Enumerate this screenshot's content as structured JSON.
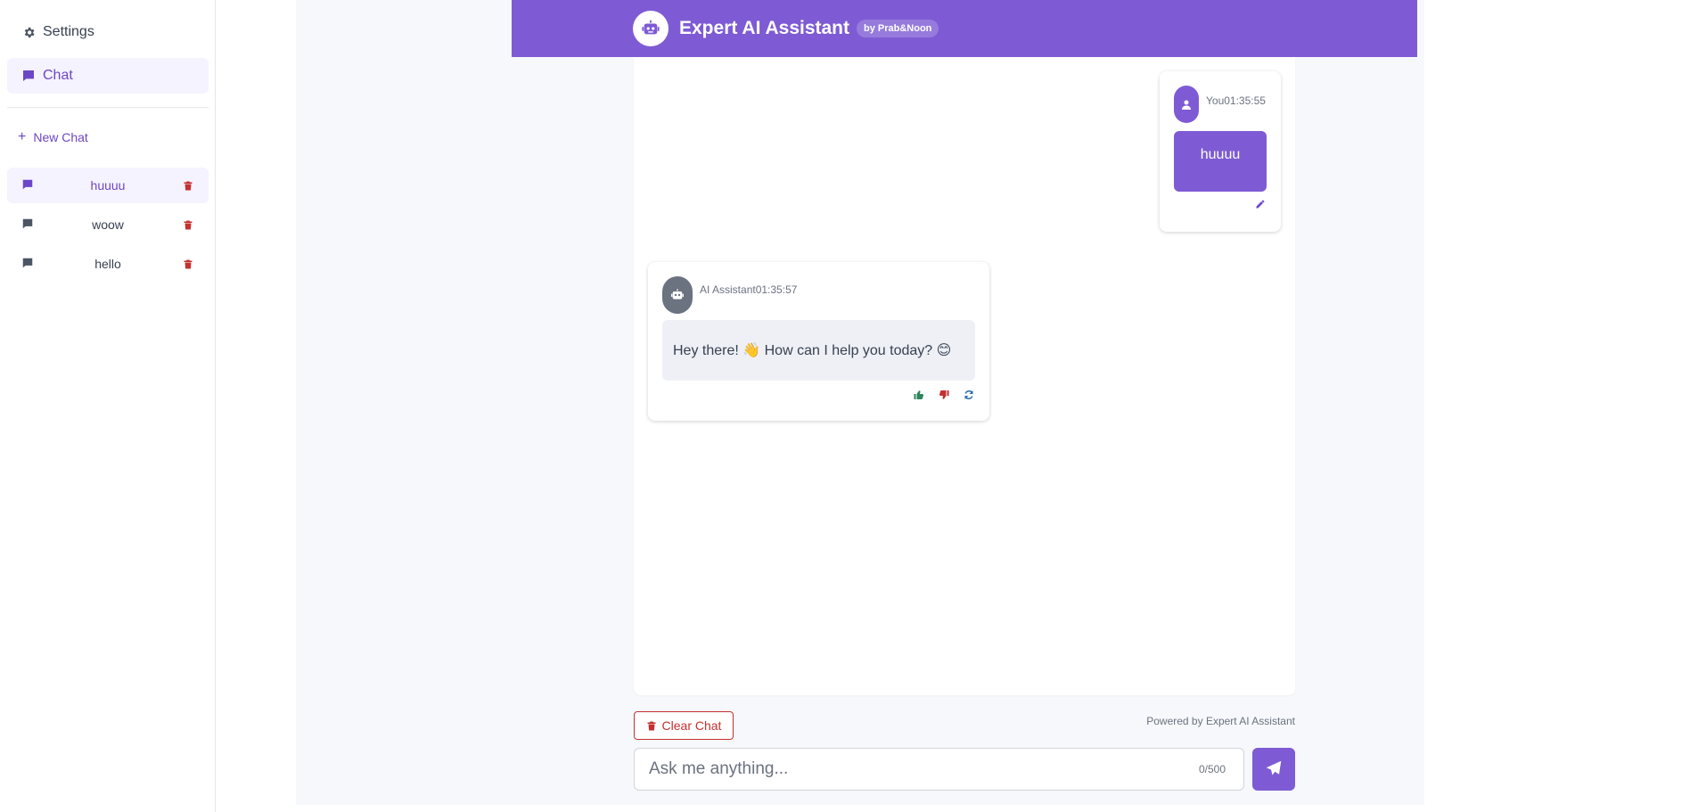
{
  "sidebar": {
    "settings_label": "Settings",
    "chat_label": "Chat",
    "new_chat_label": "New Chat",
    "history": [
      {
        "label": "huuuu",
        "active": true
      },
      {
        "label": "woow",
        "active": false
      },
      {
        "label": "hello",
        "active": false
      }
    ]
  },
  "header": {
    "title": "Expert AI Assistant",
    "byline": "by Prab&Noon"
  },
  "messages": {
    "user": {
      "author": "You",
      "time": "01:35:55",
      "text": "huuuu"
    },
    "assistant": {
      "author": "AI Assistant",
      "time": "01:35:57",
      "text": "Hey there! 👋 How can I help you today? 😊"
    }
  },
  "footer": {
    "clear_label": "Clear Chat",
    "powered_by": "Powered by Expert AI Assistant",
    "input_placeholder": "Ask me anything...",
    "char_count": "0/500"
  },
  "icons": {
    "settings": "gear-icon",
    "chat": "chat-bubble-icon",
    "new_chat": "plus-icon",
    "delete": "trash-icon",
    "bot": "robot-icon",
    "user": "user-icon",
    "edit": "pencil-icon",
    "like": "thumbs-up-icon",
    "dislike": "thumbs-down-icon",
    "regenerate": "refresh-icon",
    "send": "paper-plane-icon"
  },
  "colors": {
    "accent": "#7e5bd4",
    "danger": "#c53030",
    "like": "#2f855a"
  }
}
